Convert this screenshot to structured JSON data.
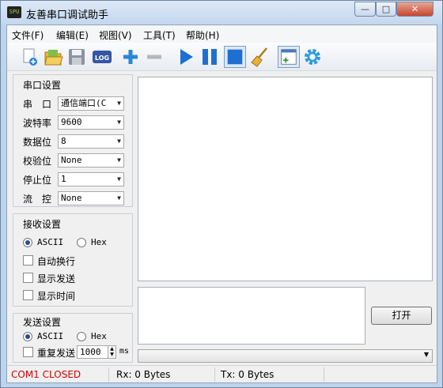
{
  "window": {
    "title": "友善串口调试助手",
    "app_icon_text": "SPU",
    "min_glyph": "—",
    "max_glyph": "□",
    "close_glyph": "✕"
  },
  "menu": [
    {
      "label": "文件(F)"
    },
    {
      "label": "编辑(E)"
    },
    {
      "label": "视图(V)"
    },
    {
      "label": "工具(T)"
    },
    {
      "label": "帮助(H)"
    }
  ],
  "toolbar": {
    "icons": [
      "new-file-icon",
      "open-folder-icon",
      "save-icon",
      "log-icon",
      "add-icon",
      "remove-icon",
      "play-icon",
      "pause-icon",
      "stop-icon",
      "clear-broom-icon",
      "add-window-icon",
      "settings-gear-icon"
    ],
    "log_text": "LOG"
  },
  "serial_settings": {
    "title": "串口设置",
    "port": {
      "label": "串　口",
      "value": "通信端口(C"
    },
    "baud": {
      "label": "波特率",
      "value": "9600"
    },
    "databits": {
      "label": "数据位",
      "value": "8"
    },
    "parity": {
      "label": "校验位",
      "value": "None"
    },
    "stopbits": {
      "label": "停止位",
      "value": "1"
    },
    "flow": {
      "label": "流　控",
      "value": "None"
    }
  },
  "receive_settings": {
    "title": "接收设置",
    "ascii_label": "ASCII",
    "hex_label": "Hex",
    "auto_wrap": "自动换行",
    "show_send": "显示发送",
    "show_time": "显示时间"
  },
  "send_settings": {
    "title": "发送设置",
    "ascii_label": "ASCII",
    "hex_label": "Hex",
    "repeat_label": "重复发送",
    "repeat_value": "1000",
    "unit": "ms"
  },
  "open_button": "打开",
  "status": {
    "port_state": "COM1 CLOSED",
    "rx": "Rx: 0 Bytes",
    "tx": "Tx: 0 Bytes"
  },
  "colors": {
    "status_closed": "#d40000",
    "accent_blue": "#1f6fd1"
  }
}
